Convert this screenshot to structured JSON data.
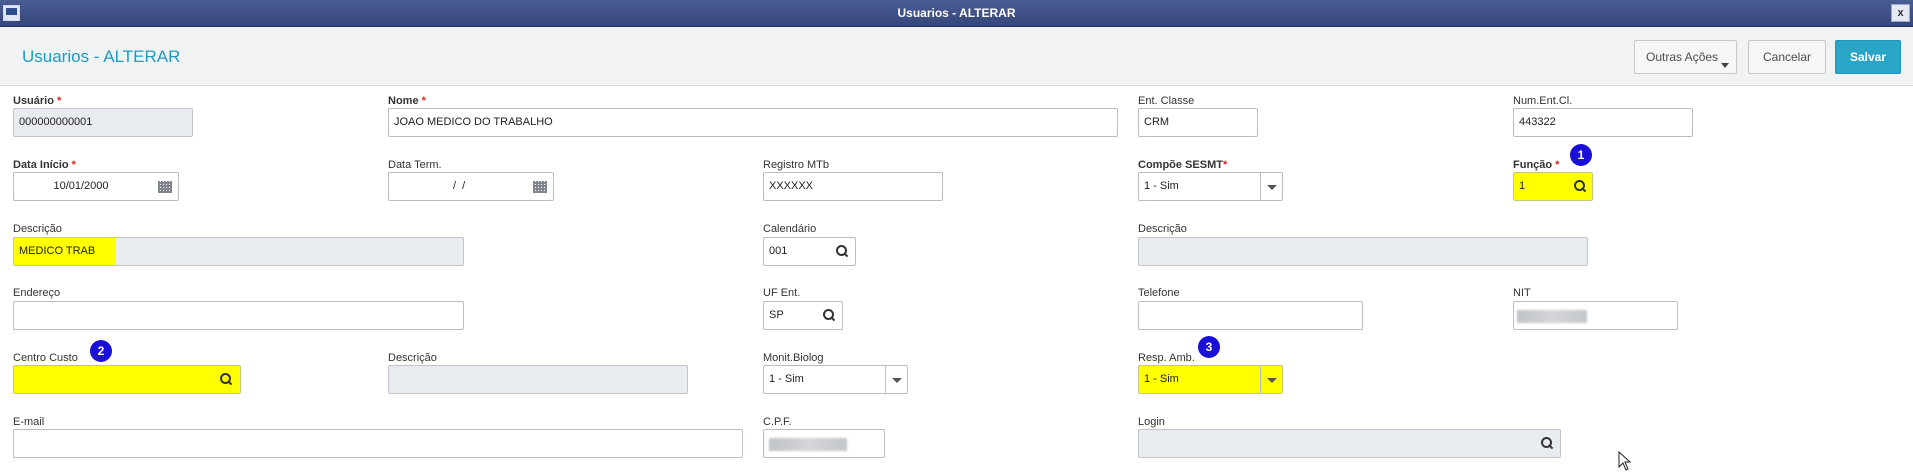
{
  "window": {
    "title": "Usuarios - ALTERAR",
    "close_glyph": "x"
  },
  "header": {
    "title": "Usuarios - ALTERAR",
    "outras_acoes": "Outras Ações",
    "cancelar": "Cancelar",
    "salvar": "Salvar",
    "accent_color": "#2aa5c8"
  },
  "fields": {
    "usuario": {
      "label": "Usuário",
      "value": "000000000001"
    },
    "nome": {
      "label": "Nome",
      "value": "JOAO MEDICO DO TRABALHO"
    },
    "ent_classe": {
      "label": "Ent. Classe",
      "value": "CRM"
    },
    "num_ent_cl": {
      "label": "Num.Ent.Cl.",
      "value": "443322"
    },
    "data_inicio": {
      "label": "Data Início",
      "value": "10/01/2000"
    },
    "data_term": {
      "label": "Data Term.",
      "value": "  /  /"
    },
    "registro_mtb": {
      "label": "Registro MTb",
      "value": "XXXXXX"
    },
    "compoe_sesmt": {
      "label": "Compõe SESMT",
      "value": "1 - Sim"
    },
    "funcao": {
      "label": "Função",
      "value": "1"
    },
    "descricao_funcao": {
      "label": "Descrição",
      "value": "MEDICO TRAB"
    },
    "calendario": {
      "label": "Calendário",
      "value": "001"
    },
    "descricao_calendario": {
      "label": "Descrição",
      "value": ""
    },
    "endereco": {
      "label": "Endereço",
      "value": ""
    },
    "uf_ent": {
      "label": "UF Ent.",
      "value": "SP"
    },
    "telefone": {
      "label": "Telefone",
      "value": ""
    },
    "nit": {
      "label": "NIT",
      "value": ""
    },
    "centro_custo": {
      "label": "Centro Custo",
      "value": ""
    },
    "descricao_cc": {
      "label": "Descrição",
      "value": ""
    },
    "monit_biolog": {
      "label": "Monit.Biolog",
      "value": "1 - Sim"
    },
    "resp_amb": {
      "label": "Resp. Amb.",
      "value": "1 - Sim"
    },
    "email": {
      "label": "E-mail",
      "value": ""
    },
    "cpf": {
      "label": "C.P.F.",
      "value": ""
    },
    "login": {
      "label": "Login",
      "value": ""
    }
  },
  "required_marker": "*",
  "annotations": {
    "badge_1": "1",
    "badge_2": "2",
    "badge_3": "3",
    "badge_color": "#1a0fd8",
    "highlight_color": "#ffff00"
  }
}
